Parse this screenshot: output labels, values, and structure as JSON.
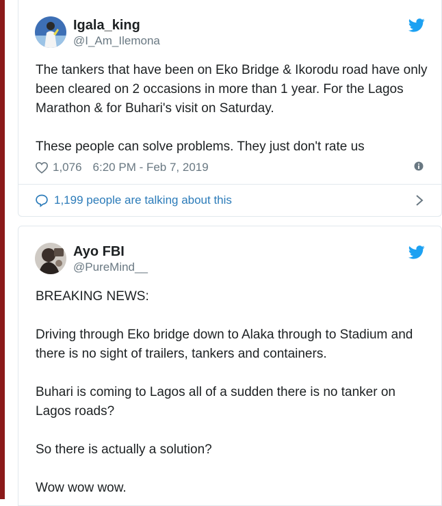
{
  "tweets": [
    {
      "name": "Igala_king",
      "handle": "@I_Am_Ilemona",
      "paragraphs": [
        "The tankers that have been on Eko Bridge & Ikorodu road have only been cleared on 2 occasions in more than 1 year. For the Lagos Marathon & for Buhari's visit on Saturday.",
        "These people can solve problems. They just don't rate us"
      ],
      "likes": "1,076",
      "timestamp": "6:20 PM - Feb 7, 2019",
      "talking": "1,199 people are talking about this"
    },
    {
      "name": "Ayo FBI",
      "handle": "@PureMind__",
      "paragraphs": [
        "BREAKING NEWS:",
        "Driving through Eko bridge down to Alaka through to Stadium and there is no sight of trailers, tankers and containers.",
        "Buhari is coming to Lagos all of a sudden there is no tanker on Lagos roads?",
        "So there is actually a solution?",
        "Wow wow wow."
      ]
    }
  ],
  "colors": {
    "twitter_blue": "#1da1f2",
    "link_blue": "#2b7bb9",
    "muted_gray": "#697882",
    "border": "#e1e8ed",
    "side_bar": "#8b1a1a"
  },
  "icons": {
    "brand": "twitter-bird-icon",
    "like": "heart-icon",
    "info": "info-icon",
    "reply": "speech-bubble-icon",
    "more": "chevron-right-icon"
  }
}
